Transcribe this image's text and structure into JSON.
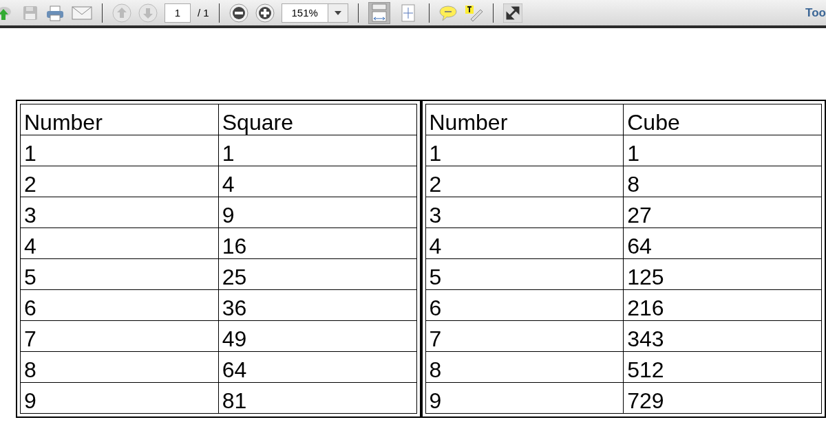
{
  "toolbar": {
    "page_number": "1",
    "page_total": "/ 1",
    "zoom": "151%",
    "view_buttons": [
      {
        "kind": "fit-width",
        "selected": true
      },
      {
        "kind": "fit-page",
        "selected": false
      }
    ],
    "tools_label": "Too"
  },
  "tables": [
    {
      "columns": [
        "Number",
        "Square"
      ],
      "rows": [
        [
          "1",
          "1"
        ],
        [
          "2",
          "4"
        ],
        [
          "3",
          "9"
        ],
        [
          "4",
          "16"
        ],
        [
          "5",
          "25"
        ],
        [
          "6",
          "36"
        ],
        [
          "7",
          "49"
        ],
        [
          "8",
          "64"
        ],
        [
          "9",
          "81"
        ]
      ]
    },
    {
      "columns": [
        "Number",
        "Cube"
      ],
      "rows": [
        [
          "1",
          "1"
        ],
        [
          "2",
          "8"
        ],
        [
          "3",
          "27"
        ],
        [
          "4",
          "64"
        ],
        [
          "5",
          "125"
        ],
        [
          "6",
          "216"
        ],
        [
          "7",
          "343"
        ],
        [
          "8",
          "512"
        ],
        [
          "9",
          "729"
        ]
      ]
    }
  ]
}
